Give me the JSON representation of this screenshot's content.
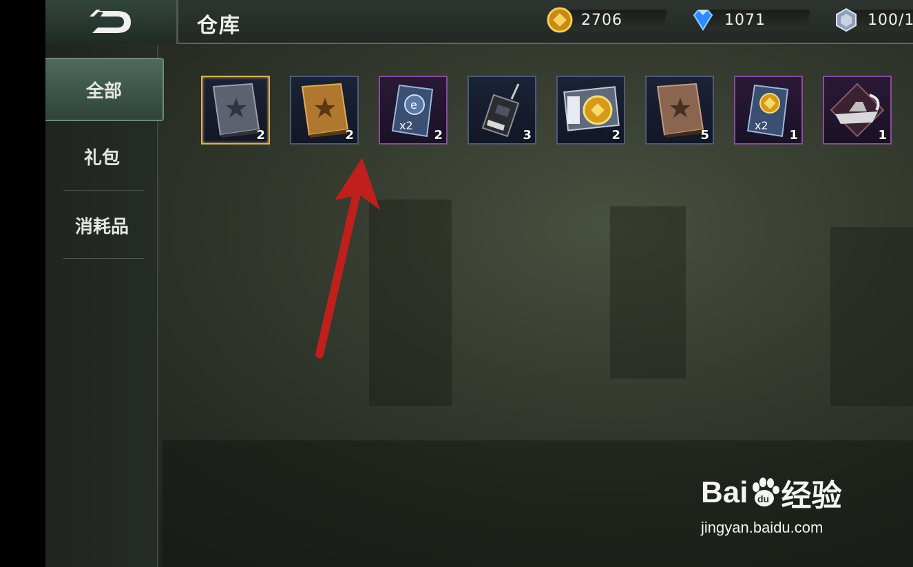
{
  "header": {
    "title": "仓库",
    "resources": [
      {
        "icon": "gold-coin-icon",
        "value": "2706"
      },
      {
        "icon": "diamond-icon",
        "value": "1071"
      },
      {
        "icon": "crystal-icon",
        "value": "100/1"
      }
    ]
  },
  "sidebar": {
    "tabs": [
      {
        "label": "全部",
        "active": true
      },
      {
        "label": "礼包",
        "active": false
      },
      {
        "label": "消耗品",
        "active": false
      }
    ]
  },
  "items": [
    {
      "icon": "silver-book-icon",
      "count": "2"
    },
    {
      "icon": "gold-book-icon",
      "count": "2"
    },
    {
      "icon": "x2-card-blue-icon",
      "count": "2"
    },
    {
      "icon": "walkie-talkie-icon",
      "count": "3"
    },
    {
      "icon": "recruit-coin-ticket-icon",
      "count": "2"
    },
    {
      "icon": "bronze-book-icon",
      "count": "5"
    },
    {
      "icon": "x2-card-gold-icon",
      "count": "1"
    },
    {
      "icon": "warship-emblem-icon",
      "count": "1"
    }
  ],
  "watermark": {
    "brand_left": "Bai",
    "brand_mid": "du",
    "brand_right": "经验",
    "url": "jingyan.baidu.com"
  },
  "colors": {
    "accent": "#d8b260",
    "arrow": "#c0201c"
  }
}
